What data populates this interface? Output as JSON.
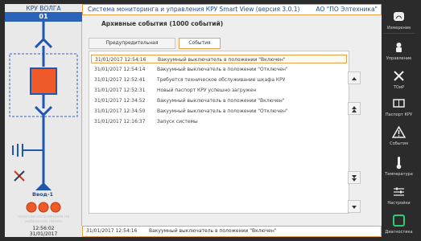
{
  "left_panel": {
    "title": "КРУ ВОЛГА",
    "number": "01",
    "bay_label": "Ввод-1",
    "warning_text": "наличие напряжения на кабельной линии",
    "clock_time": "12:56:02",
    "clock_date": "31/01/2017"
  },
  "header": {
    "title": "Система мониторинга и управления КРУ Smart View (версия 3.0.1)",
    "org": "АО \"ПО Элтехника\""
  },
  "main": {
    "archive_title": "Архивные события (1000 событий)",
    "tabs": [
      {
        "label": "Предупредительная сигнализация"
      },
      {
        "label": "События"
      }
    ],
    "events": [
      {
        "time": "31/01/2017 12:54:16",
        "message": "Вакуумный выключатель в положении \"Включен\""
      },
      {
        "time": "31/01/2017 12:54:14",
        "message": "Вакуумный выключатель в положении \"Отключен\""
      },
      {
        "time": "31/01/2017 12:52:41",
        "message": "Требуется техническое обслуживание шкафа КРУ"
      },
      {
        "time": "31/01/2017 12:52:31",
        "message": "Новый паспорт КРУ успешно загружен"
      },
      {
        "time": "31/01/2017 12:34:52",
        "message": "Вакуумный выключатель в положении \"Включен\""
      },
      {
        "time": "31/01/2017 12:34:50",
        "message": "Вакуумный выключатель в положении \"Отключен\""
      },
      {
        "time": "31/01/2017 12:16:37",
        "message": "Запуск системы"
      }
    ]
  },
  "status_bar": {
    "time": "31/01/2017 12:54:16",
    "message": "Вакуумный выключатель в положении \"Включен\""
  },
  "sidebar": {
    "items": [
      {
        "label": "Измерения",
        "icon": "measure-icon"
      },
      {
        "label": "Управление",
        "icon": "control-icon"
      },
      {
        "label": "ТОиР",
        "icon": "tools-icon"
      },
      {
        "label": "Паспорт КРУ",
        "icon": "passport-icon"
      },
      {
        "label": "События",
        "icon": "warning-icon"
      },
      {
        "label": "Температура",
        "icon": "thermometer-icon"
      },
      {
        "label": "Настройки",
        "icon": "settings-icon"
      },
      {
        "label": "Диагностика",
        "icon": "diagnostics-icon"
      }
    ]
  },
  "colors": {
    "accent": "#e9a24a",
    "brand_blue": "#2b63b8",
    "breaker_red": "#f05a28"
  }
}
